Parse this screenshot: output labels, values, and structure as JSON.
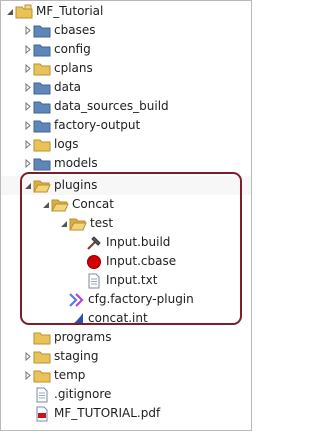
{
  "tree": {
    "root": "MF_Tutorial",
    "cbases": "cbases",
    "config": "config",
    "cplans": "cplans",
    "data": "data",
    "data_sources_build": "data_sources_build",
    "factory_output": "factory-output",
    "logs": "logs",
    "models": "models",
    "plugins": "plugins",
    "concat": "Concat",
    "test": "test",
    "input_build": "Input.build",
    "input_cbase": "Input.cbase",
    "input_txt": "Input.txt",
    "cfg_plugin": "cfg.factory-plugin",
    "concat_int": "concat.int",
    "programs": "programs",
    "staging": "staging",
    "temp": "temp",
    "gitignore": ".gitignore",
    "tutorial_pdf": "MF_TUTORIAL.pdf"
  },
  "colors": {
    "folder": "#e9c35a",
    "folder_blue": "#5f86b8",
    "highlight": "#7c1e28"
  }
}
